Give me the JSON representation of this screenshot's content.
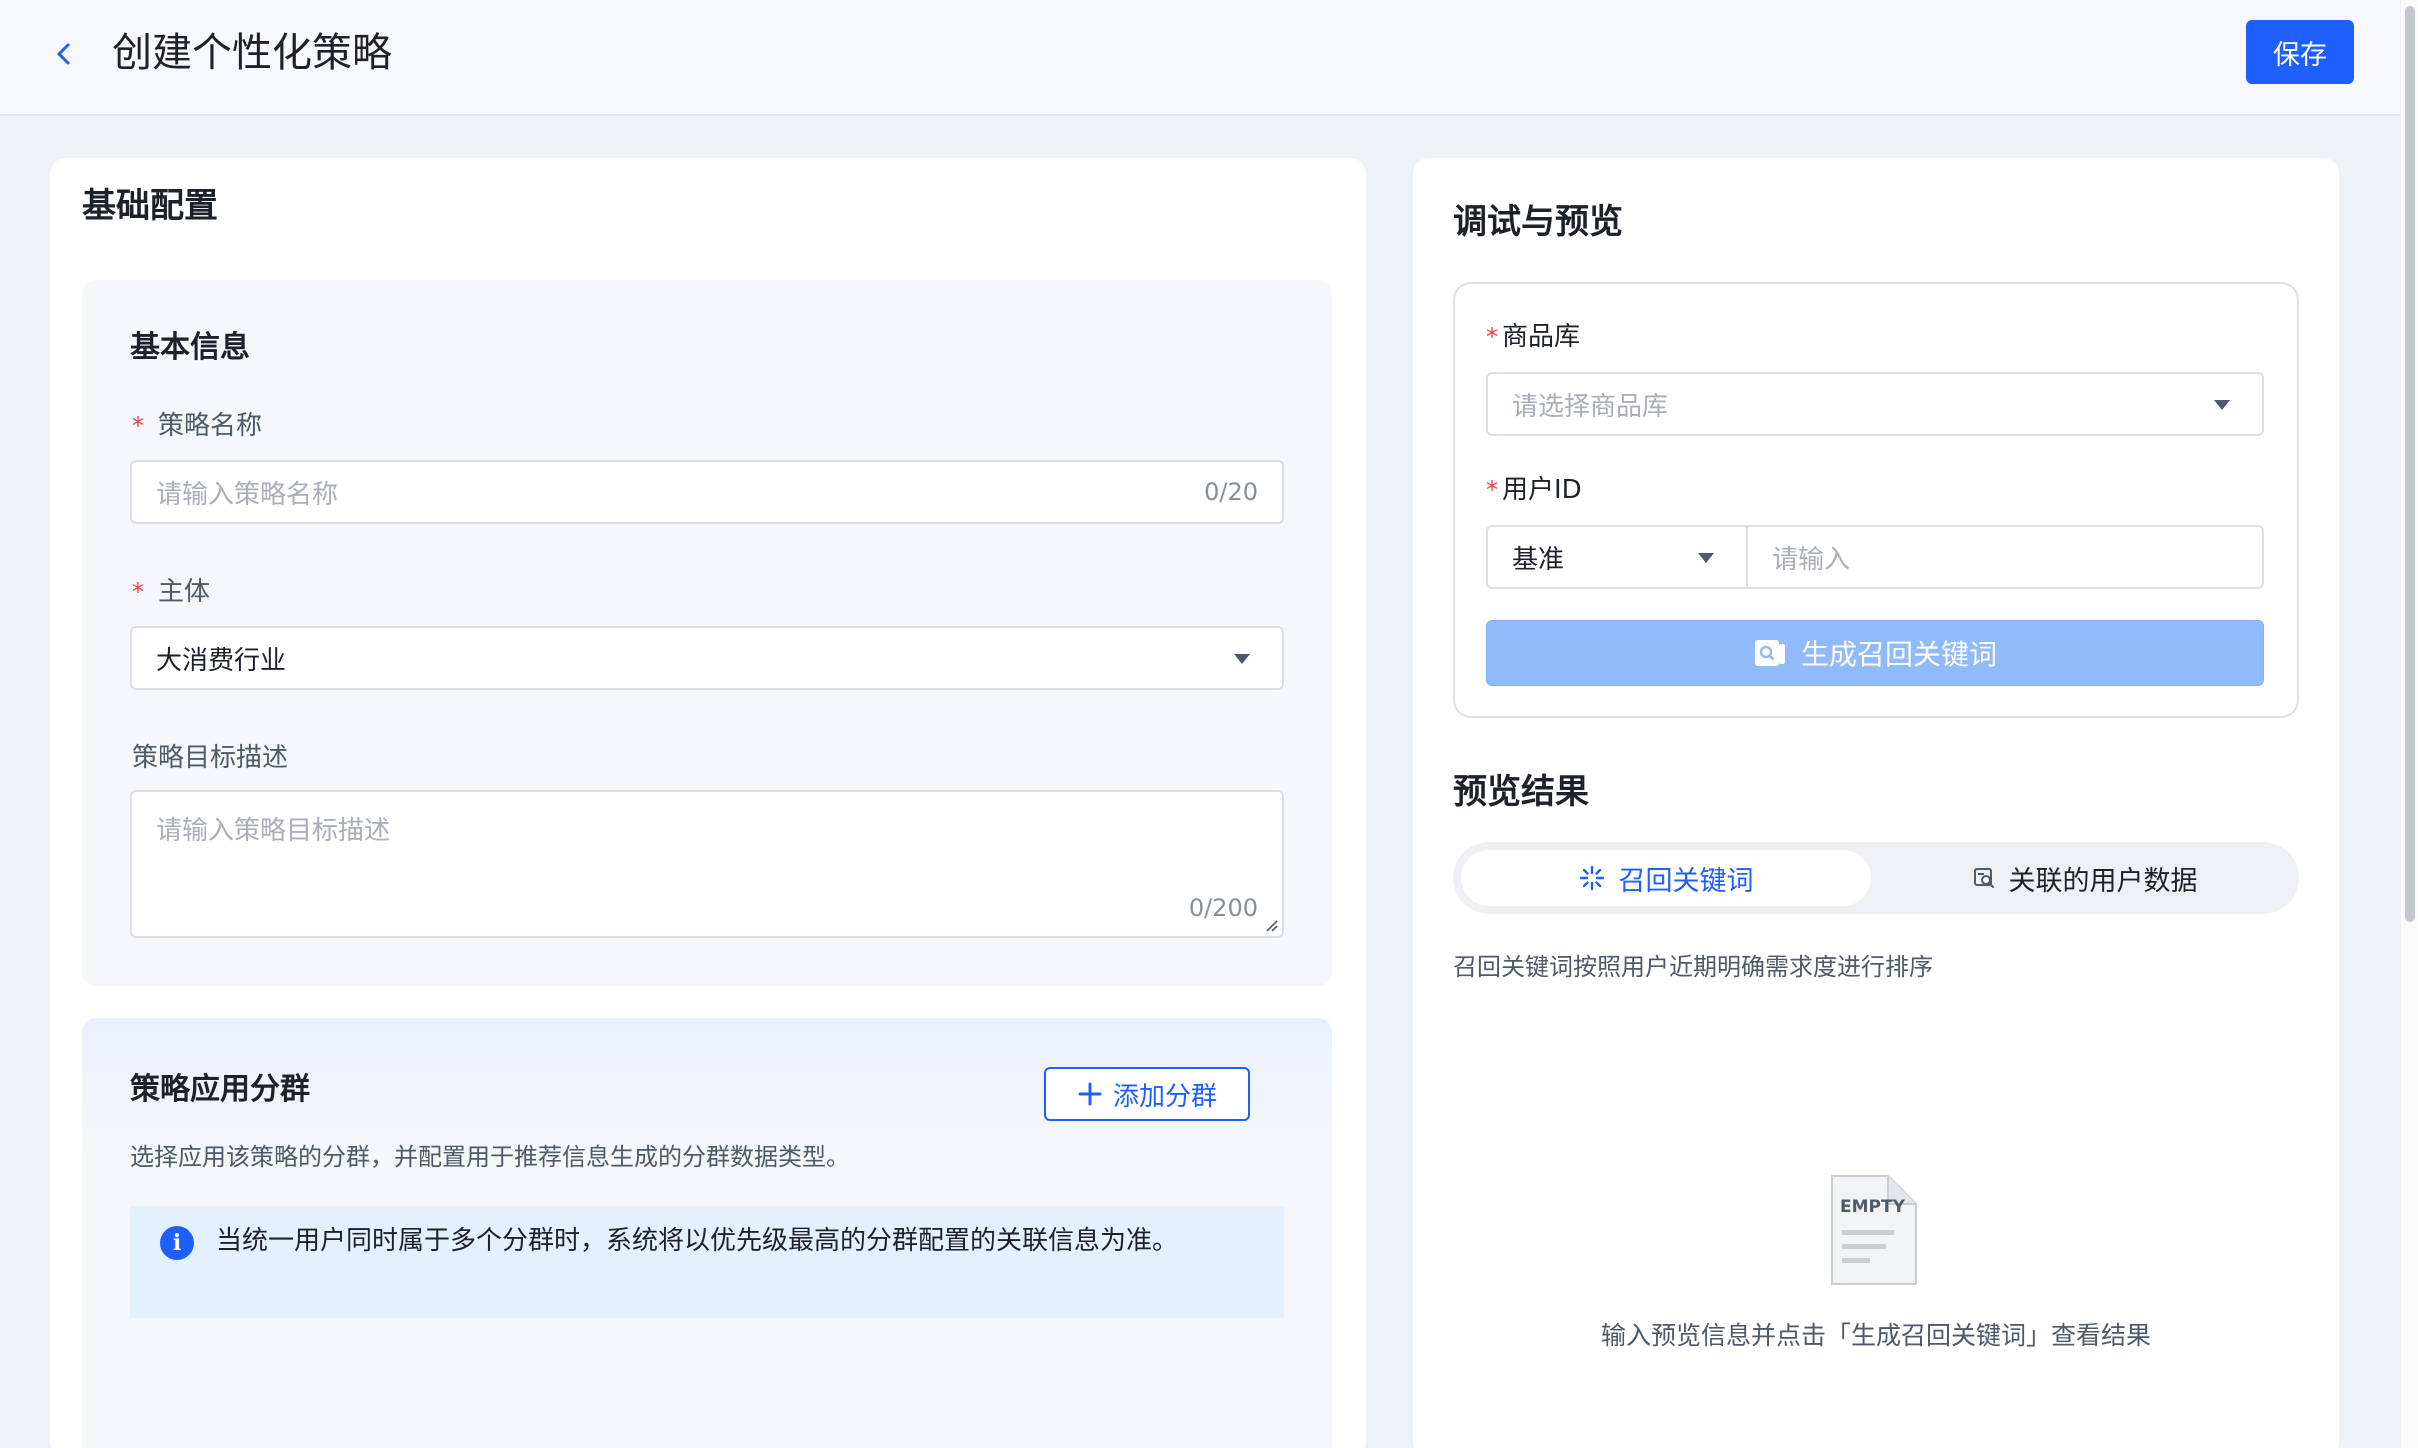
{
  "header": {
    "title": "创建个性化策略",
    "save_label": "保存"
  },
  "left": {
    "section_title": "基础配置",
    "basic_info": {
      "title": "基本信息",
      "name_label": "策略名称",
      "name_placeholder": "请输入策略名称",
      "name_counter": "0/20",
      "subject_label": "主体",
      "subject_value": "大消费行业",
      "goal_label": "策略目标描述",
      "goal_placeholder": "请输入策略目标描述",
      "goal_counter": "0/200"
    },
    "groups": {
      "title": "策略应用分群",
      "add_label": "添加分群",
      "description": "选择应用该策略的分群，并配置用于推荐信息生成的分群数据类型。",
      "info": "当统一用户同时属于多个分群时，系统将以优先级最高的分群配置的关联信息为准。"
    }
  },
  "right": {
    "section_title": "调试与预览",
    "library_label": "商品库",
    "library_placeholder": "请选择商品库",
    "user_id_label": "用户ID",
    "user_id_type": "基准",
    "user_id_placeholder": "请输入",
    "generate_label": "生成召回关键词",
    "preview_title": "预览结果",
    "tabs": [
      {
        "label": "召回关键词",
        "active": true
      },
      {
        "label": "关联的用户数据",
        "active": false
      }
    ],
    "tab_desc": "召回关键词按照用户近期明确需求度进行排序",
    "empty_badge": "EMPTY",
    "empty_text": "输入预览信息并点击「生成召回关键词」查看结果"
  },
  "colors": {
    "primary": "#1f5eff",
    "required": "#f53f3f",
    "disabled_button": "#90baf9"
  }
}
